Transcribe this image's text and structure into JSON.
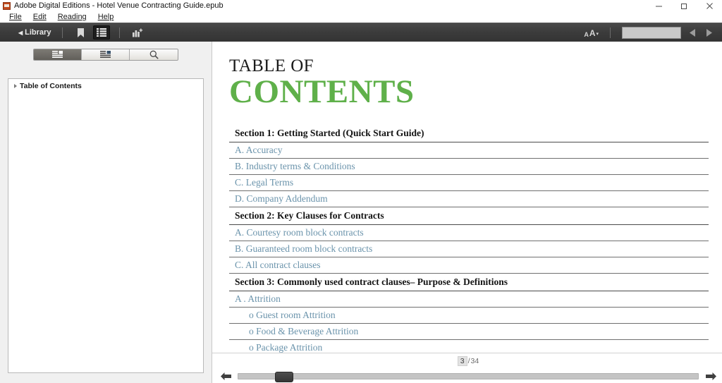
{
  "window": {
    "title": "Adobe Digital Editions - Hotel Venue Contracting Guide.epub",
    "app_icon": "adobe-digital-editions-icon",
    "minimize_label": "─",
    "maximize_label": "❐",
    "close_label": "✕"
  },
  "menu": {
    "items": [
      {
        "label": "File",
        "accesskey": "F"
      },
      {
        "label": "Edit",
        "accesskey": "E"
      },
      {
        "label": "Reading",
        "accesskey": "R"
      },
      {
        "label": "Help",
        "accesskey": "H"
      }
    ]
  },
  "toolbar": {
    "library_label": "Library",
    "back_arrow": "◀",
    "bookmark_icon": "bookmark-icon",
    "contents_icon": "table-of-contents-icon",
    "highlights_icon": "add-highlight-icon",
    "font_size_small": "A",
    "font_size_large": "A",
    "font_size_caret": "▾",
    "search_value": "",
    "search_placeholder": "",
    "prev_arrow": "◀",
    "next_arrow": "▶"
  },
  "sidebar": {
    "tabs": [
      {
        "name": "contents",
        "icon": "table-of-contents-icon",
        "active": true
      },
      {
        "name": "bookmarks",
        "icon": "bookmark-list-icon",
        "active": false
      },
      {
        "name": "search",
        "icon": "search-icon",
        "active": false
      }
    ],
    "settings_icon": "gear-icon",
    "settings_caret": "▾",
    "tree_root_label": "Table of Contents"
  },
  "reader": {
    "heading_line1": "TABLE OF",
    "heading_line2": "CONTENTS",
    "heading_color": "#5fb04a",
    "link_color": "#6a93ab",
    "entries": [
      {
        "type": "section",
        "label": "Section 1: Getting Started (Quick Start Guide)"
      },
      {
        "type": "link",
        "label": "A. Accuracy",
        "indent": false
      },
      {
        "type": "link",
        "label": "B. Industry terms & Conditions",
        "indent": false
      },
      {
        "type": "link",
        "label": "C. Legal Terms",
        "indent": false
      },
      {
        "type": "link",
        "label": "D. Company Addendum",
        "indent": false
      },
      {
        "type": "section",
        "label": "Section 2: Key Clauses for Contracts"
      },
      {
        "type": "link",
        "label": "A. Courtesy room block contracts",
        "indent": false
      },
      {
        "type": "link",
        "label": "B. Guaranteed room block contracts",
        "indent": false
      },
      {
        "type": "link",
        "label": "C. All contract clauses",
        "indent": false
      },
      {
        "type": "section",
        "label": "Section 3: Commonly used contract clauses– Purpose & Definitions"
      },
      {
        "type": "link",
        "label": "A . Attrition",
        "indent": false
      },
      {
        "type": "link",
        "label": "o Guest room Attrition",
        "indent": true
      },
      {
        "type": "link",
        "label": "o Food & Beverage Attrition",
        "indent": true
      },
      {
        "type": "link",
        "label": "o Package Attrition",
        "indent": true
      }
    ]
  },
  "bottombar": {
    "current_page": "3",
    "page_separator": "/",
    "total_pages": "34",
    "prev_page_arrow": "⬅",
    "next_page_arrow": "➡",
    "slider_position_percent": 8
  }
}
